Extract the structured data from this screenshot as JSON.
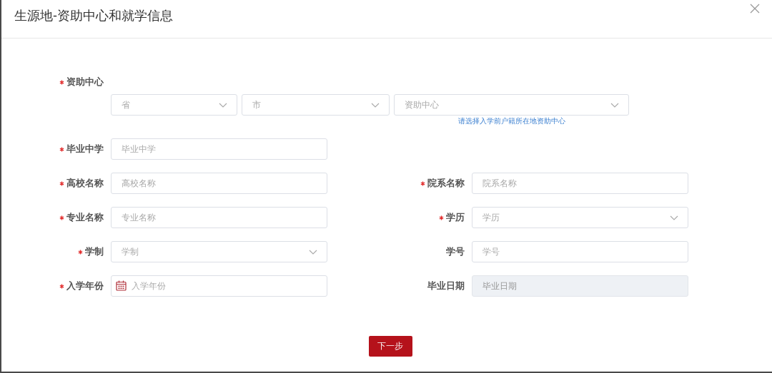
{
  "dialog": {
    "title": "生源地-资助中心和就学信息"
  },
  "aid_center": {
    "label": "资助中心",
    "required": true,
    "selects": [
      {
        "placeholder": "省"
      },
      {
        "placeholder": "市"
      },
      {
        "placeholder": "资助中心"
      }
    ],
    "hint": "请选择入学前户籍所在地资助中心"
  },
  "rows": [
    [
      {
        "label": "毕业中学",
        "required": true,
        "kind": "text",
        "placeholder": "毕业中学",
        "disabled": false
      }
    ],
    [
      {
        "label": "高校名称",
        "required": true,
        "kind": "text",
        "placeholder": "高校名称",
        "disabled": false
      },
      {
        "label": "院系名称",
        "required": true,
        "kind": "text",
        "placeholder": "院系名称",
        "disabled": false
      }
    ],
    [
      {
        "label": "专业名称",
        "required": true,
        "kind": "text",
        "placeholder": "专业名称",
        "disabled": false
      },
      {
        "label": "学历",
        "required": true,
        "kind": "select",
        "placeholder": "学历",
        "disabled": false
      }
    ],
    [
      {
        "label": "学制",
        "required": true,
        "kind": "select",
        "placeholder": "学制",
        "disabled": false
      },
      {
        "label": "学号",
        "required": false,
        "kind": "text",
        "placeholder": "学号",
        "disabled": false
      }
    ],
    [
      {
        "label": "入学年份",
        "required": true,
        "kind": "date",
        "placeholder": "入学年份",
        "disabled": false
      },
      {
        "label": "毕业日期",
        "required": false,
        "kind": "text",
        "placeholder": "毕业日期",
        "disabled": true
      }
    ]
  ],
  "next_button": {
    "label": "下一步"
  }
}
